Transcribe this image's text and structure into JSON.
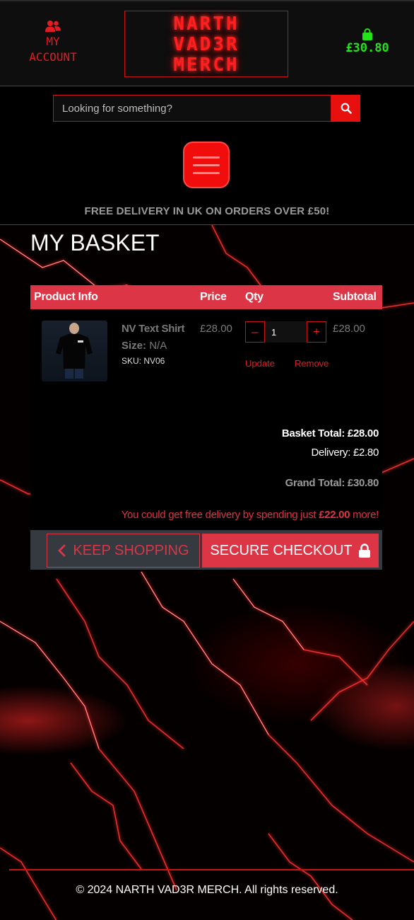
{
  "header": {
    "account_label_line1": "MY",
    "account_label_line2": "ACCOUNT",
    "logo_lines": [
      "NARTH",
      "VAD3R",
      "MERCH"
    ],
    "basket_total": "£30.80",
    "colors": {
      "accent": "#e31b23",
      "basket": "#23e31b"
    }
  },
  "search": {
    "placeholder": "Looking for something?"
  },
  "promo": "FREE DELIVERY IN UK ON ORDERS OVER £50!",
  "page_title": "MY BASKET",
  "table": {
    "headers": {
      "product": "Product Info",
      "price": "Price",
      "qty": "Qty",
      "subtotal": "Subtotal"
    },
    "items": [
      {
        "name": "NV Text Shirt",
        "size_label": "Size:",
        "size_value": "N/A",
        "sku": "SKU: NV06",
        "price": "£28.00",
        "quantity": "1",
        "subtotal": "£28.00",
        "minus": "–",
        "plus": "+",
        "update_label": "Update",
        "remove_label": "Remove"
      }
    ]
  },
  "totals": {
    "basket_total": "Basket Total: £28.00",
    "delivery": "Delivery: £2.80",
    "grand_total": "Grand Total: £30.80",
    "free_delivery_prefix": "You could get free delivery by spending just",
    "free_delivery_amount": "£22.00",
    "free_delivery_suffix": "more!"
  },
  "buttons": {
    "keep_shopping": "KEEP SHOPPING",
    "secure_checkout": "SECURE CHECKOUT"
  },
  "footer": "© 2024 NARTH VAD3R MERCH. All rights reserved."
}
